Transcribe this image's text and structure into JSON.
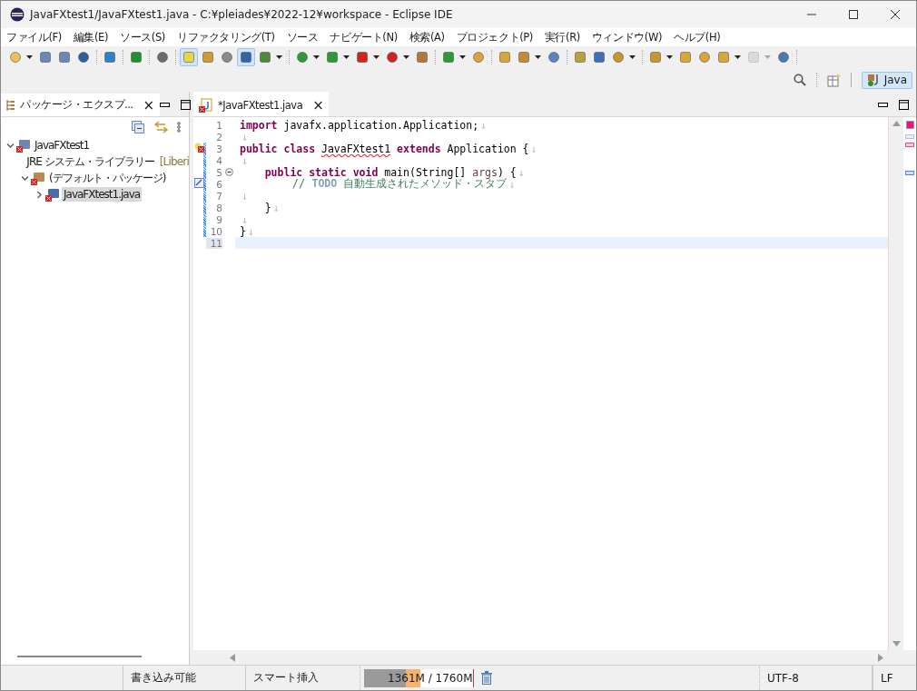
{
  "window": {
    "title": "JavaFXtest1/JavaFXtest1.java - C:¥pleiades¥2022-12¥workspace - Eclipse IDE"
  },
  "menu": [
    "ファイル(F)",
    "編集(E)",
    "ソース(S)",
    "リファクタリング(T)",
    "ソース",
    "ナビゲート(N)",
    "検索(A)",
    "プロジェクト(P)",
    "実行(R)",
    "ウィンドウ(W)",
    "ヘルプ(H)"
  ],
  "toolbar": [
    {
      "selected": false,
      "kind": "dropdown",
      "disabled": false
    },
    {
      "selected": false,
      "kind": "button",
      "disabled": false
    },
    {
      "selected": false,
      "kind": "button",
      "disabled": false
    },
    {
      "selected": false,
      "kind": "button",
      "disabled": false
    },
    {
      "selected": false,
      "kind": "button",
      "disabled": false
    },
    {
      "selected": false,
      "kind": "button",
      "disabled": false
    },
    {
      "selected": false,
      "kind": "button",
      "disabled": false
    },
    {
      "selected": true,
      "kind": "button",
      "disabled": false
    },
    {
      "selected": false,
      "kind": "button",
      "disabled": false
    },
    {
      "selected": false,
      "kind": "button",
      "disabled": false
    },
    {
      "selected": true,
      "kind": "button",
      "disabled": false
    },
    {
      "selected": false,
      "kind": "dropdown",
      "disabled": false
    },
    {
      "selected": false,
      "kind": "dropdown",
      "disabled": false
    },
    {
      "selected": false,
      "kind": "dropdown",
      "disabled": false
    },
    {
      "selected": false,
      "kind": "dropdown",
      "disabled": false
    },
    {
      "selected": false,
      "kind": "dropdown",
      "disabled": false
    },
    {
      "selected": false,
      "kind": "button",
      "disabled": false
    },
    {
      "selected": false,
      "kind": "dropdown",
      "disabled": false
    },
    {
      "selected": false,
      "kind": "button",
      "disabled": false
    },
    {
      "selected": false,
      "kind": "button",
      "disabled": false
    },
    {
      "selected": false,
      "kind": "dropdown",
      "disabled": false
    },
    {
      "selected": false,
      "kind": "button",
      "disabled": false
    },
    {
      "selected": false,
      "kind": "button",
      "disabled": false
    },
    {
      "selected": false,
      "kind": "button",
      "disabled": false
    },
    {
      "selected": false,
      "kind": "dropdown",
      "disabled": false
    },
    {
      "selected": false,
      "kind": "dropdown",
      "disabled": false
    },
    {
      "selected": false,
      "kind": "button",
      "disabled": false
    },
    {
      "selected": false,
      "kind": "button",
      "disabled": false
    },
    {
      "selected": false,
      "kind": "dropdown",
      "disabled": false
    },
    {
      "selected": false,
      "kind": "dropdown",
      "disabled": true
    },
    {
      "selected": false,
      "kind": "button",
      "disabled": false
    }
  ],
  "perspective": {
    "label": "Java",
    "selected": true
  },
  "explorer": {
    "title": "パッケージ・エクスプ...",
    "close": "×",
    "tree": [
      {
        "label": "JavaFXtest1",
        "kind": "project",
        "expanded": true,
        "selected": false,
        "children": [
          {
            "label": "JRE システム・ライブラリー",
            "decoration": "[Liberi",
            "kind": "library",
            "expanded": false,
            "selected": false
          },
          {
            "label": "(デフォルト・パッケージ)",
            "kind": "package",
            "expanded": true,
            "selected": false,
            "children": [
              {
                "label": "JavaFXtest1.java",
                "kind": "file",
                "expanded": false,
                "selected": true
              }
            ]
          }
        ]
      }
    ]
  },
  "editor": {
    "tab": {
      "label": "*JavaFXtest1.java",
      "close": "×",
      "selected": true
    },
    "lines": [
      {
        "number": "1",
        "current": false,
        "error": false,
        "task": false,
        "foldable": false,
        "changed": false,
        "tokens": [
          {
            "kind": "keyword",
            "text": "import"
          },
          {
            "kind": "plain",
            "text": " javafx.application.Application;"
          }
        ],
        "eol": "↓"
      },
      {
        "number": "2",
        "current": false,
        "error": false,
        "task": false,
        "foldable": false,
        "changed": false,
        "eol": "↓"
      },
      {
        "number": "3",
        "current": false,
        "error": true,
        "task": false,
        "foldable": false,
        "changed": true,
        "tokens": [
          {
            "kind": "keyword",
            "text": "public "
          },
          {
            "kind": "keyword",
            "text": "class "
          },
          {
            "kind": "error",
            "text": "JavaFXtest1"
          },
          {
            "kind": "keyword",
            "text": " extends"
          },
          {
            "kind": "plain",
            "text": " Application {"
          }
        ],
        "eol": "↓"
      },
      {
        "number": "4",
        "current": false,
        "error": false,
        "task": false,
        "foldable": false,
        "changed": true,
        "eol": "↓"
      },
      {
        "number": "5",
        "current": false,
        "error": false,
        "task": false,
        "foldable": true,
        "changed": true,
        "tokens": [
          {
            "kind": "keyword",
            "text": "    public "
          },
          {
            "kind": "keyword",
            "text": "static "
          },
          {
            "kind": "keyword",
            "text": "void"
          },
          {
            "kind": "plain",
            "text": " main(String[] "
          },
          {
            "kind": "param",
            "text": "args"
          },
          {
            "kind": "plain",
            "text": ") {"
          }
        ],
        "eol": "↓"
      },
      {
        "number": "6",
        "current": false,
        "error": false,
        "task": true,
        "foldable": false,
        "changed": true,
        "tokens": [
          {
            "kind": "comment",
            "text": "        // "
          },
          {
            "kind": "todo",
            "text": "TODO"
          },
          {
            "kind": "comment",
            "text": " 自動生成されたメソッド・スタブ"
          }
        ],
        "eol": "↓"
      },
      {
        "number": "7",
        "current": false,
        "error": false,
        "task": false,
        "foldable": false,
        "changed": true,
        "eol": "↓"
      },
      {
        "number": "8",
        "current": false,
        "error": false,
        "task": false,
        "foldable": false,
        "changed": true,
        "tokens": [
          {
            "kind": "plain",
            "text": "    }"
          }
        ],
        "eol": "↓"
      },
      {
        "number": "9",
        "current": false,
        "error": false,
        "task": false,
        "foldable": false,
        "changed": true,
        "eol": "↓"
      },
      {
        "number": "10",
        "current": false,
        "error": false,
        "task": false,
        "foldable": false,
        "changed": true,
        "tokens": [
          {
            "kind": "plain",
            "text": "}"
          }
        ],
        "eol": "↓"
      },
      {
        "number": "11",
        "current": true,
        "error": false,
        "task": false,
        "foldable": false,
        "changed": false
      }
    ]
  },
  "status_bar": {
    "writable": "書き込み可能",
    "insert_mode": "スマート挿入",
    "heap": {
      "used": "1361M",
      "total": "/ 1760M",
      "level": 0.52
    },
    "encoding": "UTF-8",
    "line_delimiter": "LF"
  }
}
